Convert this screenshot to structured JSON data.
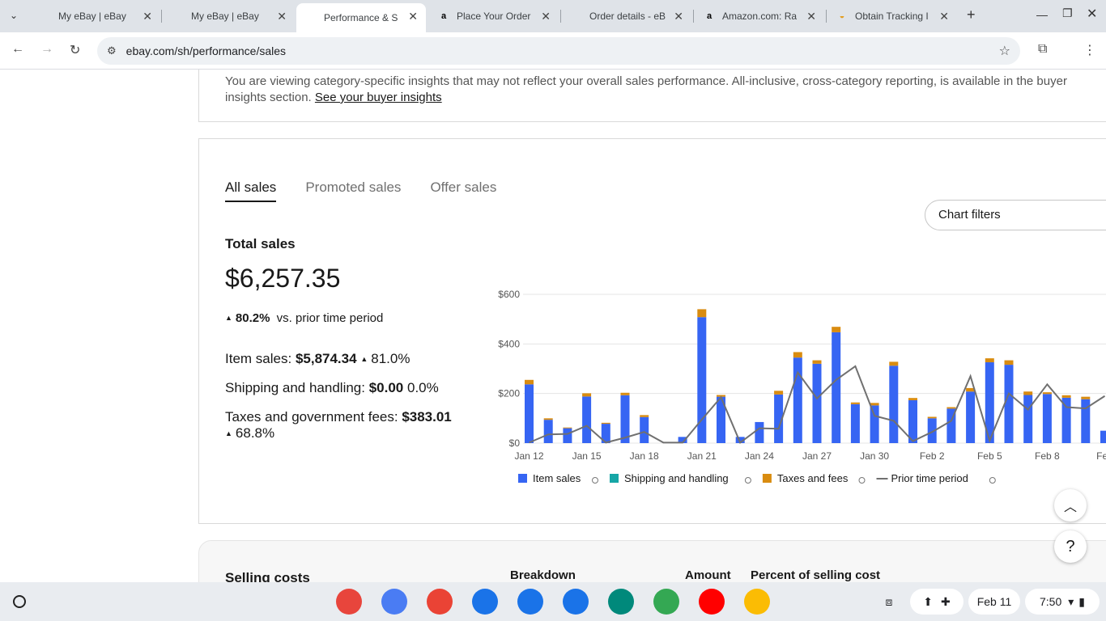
{
  "browser": {
    "tabs": [
      {
        "title": "My eBay | eBay",
        "icon": "ebay-icon"
      },
      {
        "title": "My eBay | eBay",
        "icon": "ebay-icon"
      },
      {
        "title": "Performance & Sales",
        "icon": "ebay-icon"
      },
      {
        "title": "Place Your Order",
        "icon": "amazon-icon"
      },
      {
        "title": "Order details - eBay",
        "icon": "ebay-icon"
      },
      {
        "title": "Amazon.com: Ra",
        "icon": "amazon-icon"
      },
      {
        "title": "Obtain Tracking I",
        "icon": "taco-icon"
      }
    ],
    "url": "ebay.com/sh/performance/sales"
  },
  "notice": {
    "text": "You are viewing category-specific insights that may not reflect your overall sales performance. All-inclusive, cross-category reporting, is available in the buyer insights section.",
    "link": "See your buyer insights"
  },
  "sales": {
    "tabs": [
      "All sales",
      "Promoted sales",
      "Offer sales"
    ],
    "total_label": "Total sales",
    "total_value": "$6,257.35",
    "delta_pct": "80.2%",
    "delta_text": "vs. prior time period",
    "item_label": "Item sales:",
    "item_value": "$5,874.34",
    "item_delta": "81.0%",
    "ship_label": "Shipping and handling:",
    "ship_value": "$0.00",
    "ship_delta": "0.0%",
    "tax_label": "Taxes and government fees:",
    "tax_value": "$383.01",
    "tax_delta": "68.8%",
    "filters_label": "Chart filters"
  },
  "chart_data": {
    "type": "bar",
    "y_ticks": [
      "$600",
      "$400",
      "$200",
      "$0"
    ],
    "ylim": [
      0,
      600
    ],
    "x_tick_labels": [
      "Jan 12",
      "Jan 15",
      "Jan 18",
      "Jan 21",
      "Jan 24",
      "Jan 27",
      "Jan 30",
      "Feb 2",
      "Feb 5",
      "Feb 8",
      "Feb"
    ],
    "dates": [
      "Jan 12",
      "Jan 13",
      "Jan 14",
      "Jan 15",
      "Jan 16",
      "Jan 17",
      "Jan 18",
      "Jan 19",
      "Jan 20",
      "Jan 21",
      "Jan 22",
      "Jan 23",
      "Jan 24",
      "Jan 25",
      "Jan 26",
      "Jan 27",
      "Jan 28",
      "Jan 29",
      "Jan 30",
      "Jan 31",
      "Feb 1",
      "Feb 2",
      "Feb 3",
      "Feb 4",
      "Feb 5",
      "Feb 6",
      "Feb 7",
      "Feb 8",
      "Feb 9",
      "Feb 10",
      "Feb 11"
    ],
    "series": [
      {
        "name": "Item sales",
        "color": "#3665f3",
        "values": [
          237,
          94,
          60,
          188,
          78,
          193,
          105,
          0,
          25,
          508,
          187,
          25,
          85,
          196,
          345,
          320,
          447,
          157,
          152,
          312,
          173,
          100,
          139,
          208,
          326,
          316,
          194,
          198,
          183,
          177,
          50
        ]
      },
      {
        "name": "Shipping and handling",
        "color": "#16a6a6",
        "values": [
          0,
          0,
          0,
          0,
          0,
          0,
          0,
          0,
          0,
          0,
          0,
          0,
          0,
          0,
          0,
          0,
          0,
          0,
          0,
          0,
          0,
          0,
          0,
          0,
          0,
          0,
          0,
          0,
          0,
          0,
          0
        ]
      },
      {
        "name": "Taxes and fees",
        "color": "#d98c10",
        "values": [
          18,
          6,
          3,
          13,
          4,
          10,
          8,
          0,
          0,
          32,
          7,
          0,
          0,
          15,
          22,
          14,
          22,
          7,
          10,
          16,
          9,
          6,
          6,
          14,
          16,
          18,
          14,
          7,
          10,
          10,
          0
        ]
      },
      {
        "name": "Prior time period",
        "color": "#707070",
        "type": "line",
        "values": [
          2,
          35,
          37,
          70,
          2,
          22,
          45,
          2,
          2,
          95,
          185,
          2,
          60,
          58,
          285,
          180,
          255,
          310,
          110,
          90,
          8,
          45,
          90,
          270,
          10,
          200,
          135,
          237,
          145,
          140,
          190
        ]
      }
    ],
    "legend": [
      "Item sales",
      "Shipping and handling",
      "Taxes and fees",
      "Prior time period"
    ]
  },
  "costs": {
    "title": "Selling costs",
    "columns": [
      "Breakdown",
      "Amount",
      "Percent of selling cost"
    ]
  },
  "shelf": {
    "date": "Feb 11",
    "time": "7:50",
    "apps": [
      {
        "name": "chrome-icon",
        "color": "#e8453c"
      },
      {
        "name": "gemini-icon",
        "color": "#4a7cf3"
      },
      {
        "name": "gmail-icon",
        "color": "#ea4335"
      },
      {
        "name": "calendar-icon",
        "color": "#1a73e8"
      },
      {
        "name": "files-icon",
        "color": "#1a73e8"
      },
      {
        "name": "messages-icon",
        "color": "#1a73e8"
      },
      {
        "name": "meet-icon",
        "color": "#00897b"
      },
      {
        "name": "play-store-icon",
        "color": "#34a853"
      },
      {
        "name": "youtube-icon",
        "color": "#ff0000"
      },
      {
        "name": "photos-icon",
        "color": "#fbbc04"
      }
    ]
  }
}
